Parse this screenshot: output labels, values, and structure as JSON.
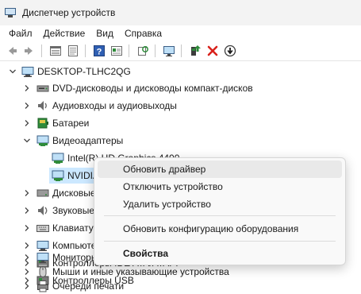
{
  "window": {
    "title": "Диспетчер устройств"
  },
  "menu": {
    "file": "Файл",
    "action": "Действие",
    "view": "Вид",
    "help": "Справка"
  },
  "toolbar": {
    "icons": [
      "back-icon",
      "forward-icon",
      "properties-icon",
      "show-hidden-icon",
      "help-icon",
      "properties-sheet-icon",
      "refresh-icon",
      "monitor-icon",
      "add-driver-icon",
      "uninstall-icon",
      "disable-icon"
    ],
    "colors": {
      "uninstall": "#d9221c",
      "add_driver": "#2e8b3a"
    }
  },
  "tree": {
    "root": "DESKTOP-TLHC2QG",
    "categories": [
      {
        "label": "DVD-дисководы и дисководы компакт-дисков",
        "icon": "dvd-drive-icon"
      },
      {
        "label": "Аудиовходы и аудиовыходы",
        "icon": "audio-io-icon"
      },
      {
        "label": "Батареи",
        "icon": "battery-icon"
      },
      {
        "label": "Видеоадаптеры",
        "icon": "display-adapter-icon",
        "expanded": true,
        "children": [
          {
            "label": "Intel(R) HD Graphics 4400",
            "icon": "display-adapter-icon"
          },
          {
            "label": "NVIDIA GeForce GTX 750 Ti",
            "icon": "display-adapter-icon",
            "selected": true
          }
        ]
      },
      {
        "label": "Дисковые устройства",
        "icon": "disk-drive-icon"
      },
      {
        "label": "Звуковые, игровые и видеоустройства",
        "icon": "sound-icon"
      },
      {
        "label": "Клавиатуры",
        "icon": "keyboard-icon"
      },
      {
        "label": "Компьютер",
        "icon": "computer-icon"
      },
      {
        "label": "Контроллеры IDE ATA/ATAPI",
        "icon": "ide-controller-icon"
      },
      {
        "label": "Контроллеры USB",
        "icon": "usb-controller-icon"
      },
      {
        "label": "Мониторы",
        "icon": "monitor-icon"
      },
      {
        "label": "Мыши и иные указывающие устройства",
        "icon": "mouse-icon"
      },
      {
        "label": "Очереди печати",
        "icon": "print-queue-icon"
      }
    ]
  },
  "context_menu": {
    "items": [
      {
        "label": "Обновить драйвер",
        "hover": true
      },
      {
        "label": "Отключить устройство"
      },
      {
        "label": "Удалить устройство"
      },
      {
        "label": "Обновить конфигурацию оборудования"
      },
      {
        "label": "Свойства",
        "bold": true
      }
    ]
  },
  "colors": {
    "selection": "#cce8ff",
    "accent": "#0067c0"
  }
}
